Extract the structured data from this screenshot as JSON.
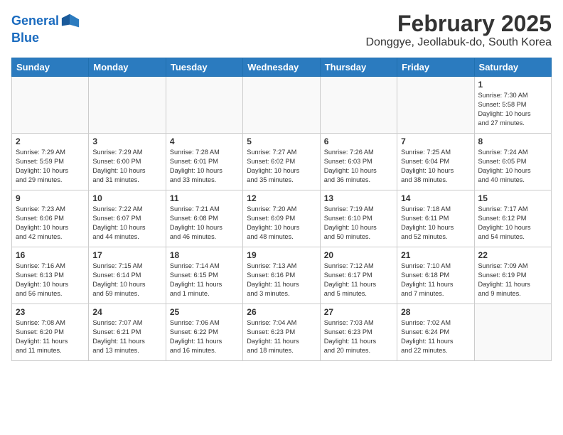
{
  "header": {
    "logo_line1": "General",
    "logo_line2": "Blue",
    "title": "February 2025",
    "subtitle": "Donggye, Jeollabuk-do, South Korea"
  },
  "days_of_week": [
    "Sunday",
    "Monday",
    "Tuesday",
    "Wednesday",
    "Thursday",
    "Friday",
    "Saturday"
  ],
  "weeks": [
    [
      {
        "day": "",
        "info": ""
      },
      {
        "day": "",
        "info": ""
      },
      {
        "day": "",
        "info": ""
      },
      {
        "day": "",
        "info": ""
      },
      {
        "day": "",
        "info": ""
      },
      {
        "day": "",
        "info": ""
      },
      {
        "day": "1",
        "info": "Sunrise: 7:30 AM\nSunset: 5:58 PM\nDaylight: 10 hours\nand 27 minutes."
      }
    ],
    [
      {
        "day": "2",
        "info": "Sunrise: 7:29 AM\nSunset: 5:59 PM\nDaylight: 10 hours\nand 29 minutes."
      },
      {
        "day": "3",
        "info": "Sunrise: 7:29 AM\nSunset: 6:00 PM\nDaylight: 10 hours\nand 31 minutes."
      },
      {
        "day": "4",
        "info": "Sunrise: 7:28 AM\nSunset: 6:01 PM\nDaylight: 10 hours\nand 33 minutes."
      },
      {
        "day": "5",
        "info": "Sunrise: 7:27 AM\nSunset: 6:02 PM\nDaylight: 10 hours\nand 35 minutes."
      },
      {
        "day": "6",
        "info": "Sunrise: 7:26 AM\nSunset: 6:03 PM\nDaylight: 10 hours\nand 36 minutes."
      },
      {
        "day": "7",
        "info": "Sunrise: 7:25 AM\nSunset: 6:04 PM\nDaylight: 10 hours\nand 38 minutes."
      },
      {
        "day": "8",
        "info": "Sunrise: 7:24 AM\nSunset: 6:05 PM\nDaylight: 10 hours\nand 40 minutes."
      }
    ],
    [
      {
        "day": "9",
        "info": "Sunrise: 7:23 AM\nSunset: 6:06 PM\nDaylight: 10 hours\nand 42 minutes."
      },
      {
        "day": "10",
        "info": "Sunrise: 7:22 AM\nSunset: 6:07 PM\nDaylight: 10 hours\nand 44 minutes."
      },
      {
        "day": "11",
        "info": "Sunrise: 7:21 AM\nSunset: 6:08 PM\nDaylight: 10 hours\nand 46 minutes."
      },
      {
        "day": "12",
        "info": "Sunrise: 7:20 AM\nSunset: 6:09 PM\nDaylight: 10 hours\nand 48 minutes."
      },
      {
        "day": "13",
        "info": "Sunrise: 7:19 AM\nSunset: 6:10 PM\nDaylight: 10 hours\nand 50 minutes."
      },
      {
        "day": "14",
        "info": "Sunrise: 7:18 AM\nSunset: 6:11 PM\nDaylight: 10 hours\nand 52 minutes."
      },
      {
        "day": "15",
        "info": "Sunrise: 7:17 AM\nSunset: 6:12 PM\nDaylight: 10 hours\nand 54 minutes."
      }
    ],
    [
      {
        "day": "16",
        "info": "Sunrise: 7:16 AM\nSunset: 6:13 PM\nDaylight: 10 hours\nand 56 minutes."
      },
      {
        "day": "17",
        "info": "Sunrise: 7:15 AM\nSunset: 6:14 PM\nDaylight: 10 hours\nand 59 minutes."
      },
      {
        "day": "18",
        "info": "Sunrise: 7:14 AM\nSunset: 6:15 PM\nDaylight: 11 hours\nand 1 minute."
      },
      {
        "day": "19",
        "info": "Sunrise: 7:13 AM\nSunset: 6:16 PM\nDaylight: 11 hours\nand 3 minutes."
      },
      {
        "day": "20",
        "info": "Sunrise: 7:12 AM\nSunset: 6:17 PM\nDaylight: 11 hours\nand 5 minutes."
      },
      {
        "day": "21",
        "info": "Sunrise: 7:10 AM\nSunset: 6:18 PM\nDaylight: 11 hours\nand 7 minutes."
      },
      {
        "day": "22",
        "info": "Sunrise: 7:09 AM\nSunset: 6:19 PM\nDaylight: 11 hours\nand 9 minutes."
      }
    ],
    [
      {
        "day": "23",
        "info": "Sunrise: 7:08 AM\nSunset: 6:20 PM\nDaylight: 11 hours\nand 11 minutes."
      },
      {
        "day": "24",
        "info": "Sunrise: 7:07 AM\nSunset: 6:21 PM\nDaylight: 11 hours\nand 13 minutes."
      },
      {
        "day": "25",
        "info": "Sunrise: 7:06 AM\nSunset: 6:22 PM\nDaylight: 11 hours\nand 16 minutes."
      },
      {
        "day": "26",
        "info": "Sunrise: 7:04 AM\nSunset: 6:23 PM\nDaylight: 11 hours\nand 18 minutes."
      },
      {
        "day": "27",
        "info": "Sunrise: 7:03 AM\nSunset: 6:23 PM\nDaylight: 11 hours\nand 20 minutes."
      },
      {
        "day": "28",
        "info": "Sunrise: 7:02 AM\nSunset: 6:24 PM\nDaylight: 11 hours\nand 22 minutes."
      },
      {
        "day": "",
        "info": ""
      }
    ]
  ]
}
